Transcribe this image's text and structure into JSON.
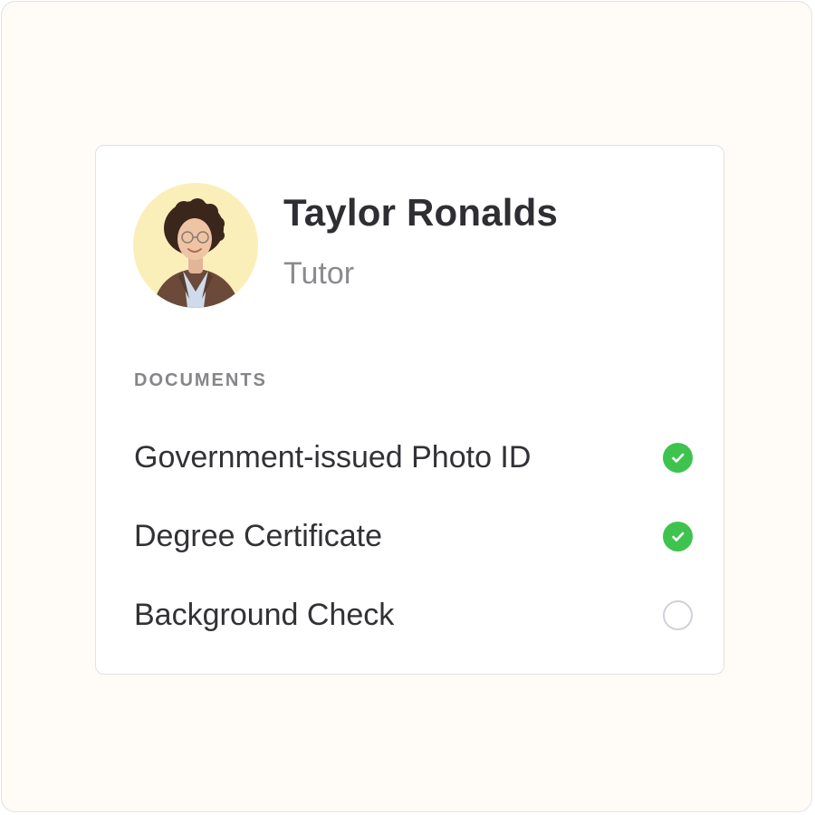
{
  "profile": {
    "name": "Taylor Ronalds",
    "role": "Tutor",
    "avatar_icon": "person-photo",
    "avatar_bg": "#fbefb9"
  },
  "documents": {
    "section_label": "DOCUMENTS",
    "items": [
      {
        "label": "Government-issued Photo ID",
        "status": "complete",
        "icon": "check-circle-icon"
      },
      {
        "label": "Degree Certificate",
        "status": "complete",
        "icon": "check-circle-icon"
      },
      {
        "label": "Background Check",
        "status": "pending",
        "icon": "empty-circle-icon"
      }
    ]
  },
  "colors": {
    "complete": "#3ec44e",
    "pending_border": "#ced1d8",
    "background": "#fffbf7"
  }
}
